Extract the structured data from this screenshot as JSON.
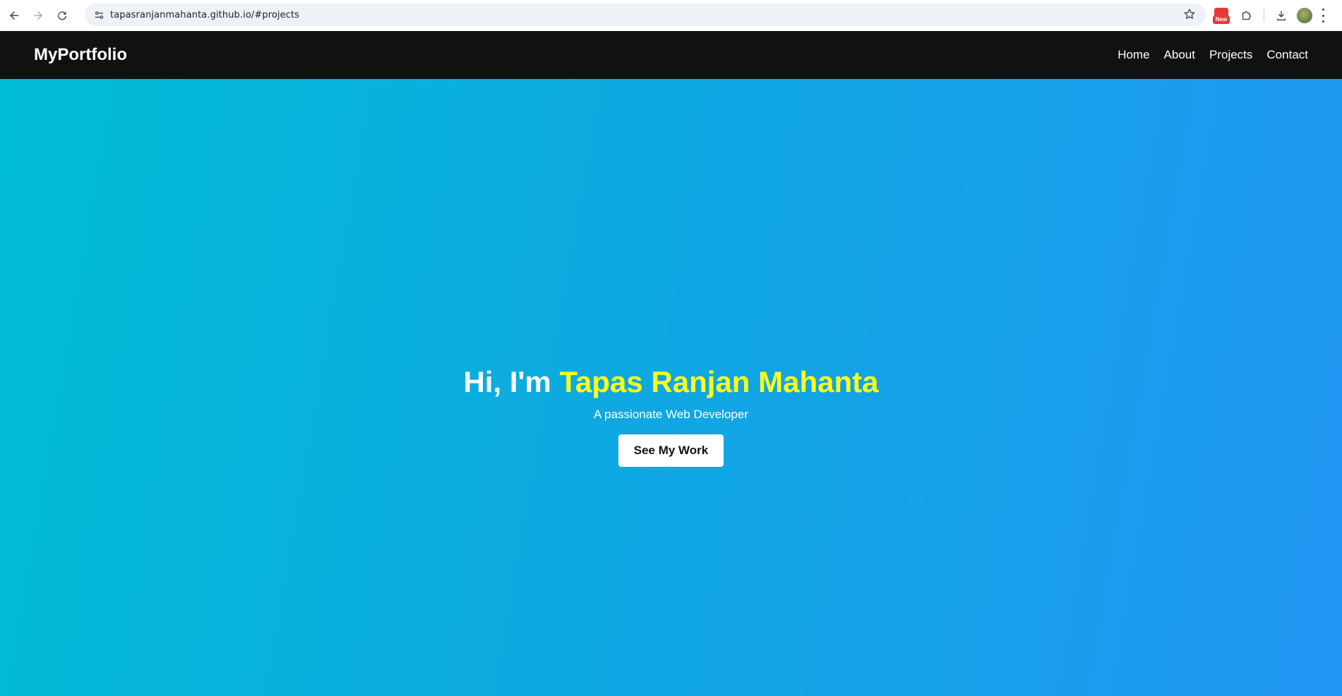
{
  "browser": {
    "url": "tapasranjanmahanta.github.io/#projects",
    "extension_badge": "New",
    "icons": [
      "back-arrow-icon",
      "forward-arrow-icon",
      "reload-icon",
      "site-info-icon",
      "bookmark-star-icon",
      "extension-new-icon",
      "puzzle-extensions-icon",
      "download-icon",
      "profile-avatar",
      "menu-kebab-icon"
    ]
  },
  "site": {
    "logo": "MyPortfolio",
    "nav": {
      "home": "Home",
      "about": "About",
      "projects": "Projects",
      "contact": "Contact"
    }
  },
  "hero": {
    "greeting": "Hi, I'm ",
    "name": "Tapas Ranjan Mahanta",
    "subtitle": "A passionate Web Developer",
    "cta": "See My Work"
  },
  "colors": {
    "nav_bg": "#111111",
    "hero_gradient_start": "#00bcd4",
    "hero_gradient_end": "#2196f3",
    "name_highlight": "#ffff1a",
    "button_bg": "#ffffff"
  }
}
